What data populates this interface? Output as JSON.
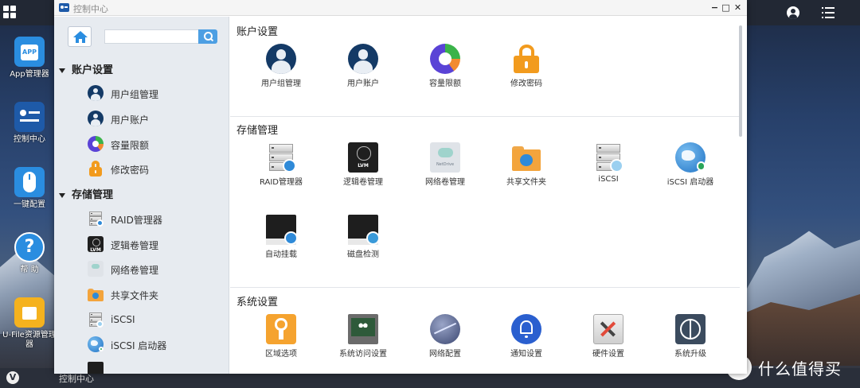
{
  "desktop": {
    "icons": [
      {
        "label": "App管理器",
        "icon": "app-store-icon"
      },
      {
        "label": "控制中心",
        "icon": "control-center-icon"
      },
      {
        "label": "一键配置",
        "icon": "mouse-icon"
      },
      {
        "label": "帮 助",
        "icon": "help-icon"
      },
      {
        "label": "U-File资源管理器",
        "icon": "file-manager-icon"
      }
    ],
    "taskbar_task": "控制中心",
    "watermark": "什么值得买",
    "watermark_badge": "值"
  },
  "window": {
    "title": "控制中心",
    "buttons": {
      "minimize": "−",
      "maximize": "□",
      "close": "✕"
    }
  },
  "sidebar": {
    "search": {
      "value": "",
      "placeholder": ""
    },
    "groups": [
      {
        "label": "账户设置",
        "items": [
          "用户组管理",
          "用户账户",
          "容量限额",
          "修改密码"
        ]
      },
      {
        "label": "存储管理",
        "items": [
          "RAID管理器",
          "逻辑卷管理",
          "网络卷管理",
          "共享文件夹",
          "iSCSI",
          "iSCSI 启动器"
        ]
      }
    ]
  },
  "content": {
    "sections": [
      {
        "title": "账户设置",
        "tiles": [
          {
            "label": "用户组管理",
            "icon": "user-group-icon"
          },
          {
            "label": "用户账户",
            "icon": "user-account-icon"
          },
          {
            "label": "容量限额",
            "icon": "quota-icon"
          },
          {
            "label": "修改密码",
            "icon": "lock-icon"
          }
        ]
      },
      {
        "title": "存储管理",
        "tiles": [
          {
            "label": "RAID管理器",
            "icon": "raid-icon"
          },
          {
            "label": "逻辑卷管理",
            "icon": "lvm-icon",
            "text": "LVM"
          },
          {
            "label": "网络卷管理",
            "icon": "net-drive-icon",
            "text": "NetDrive"
          },
          {
            "label": "共享文件夹",
            "icon": "shared-folder-icon"
          },
          {
            "label": "iSCSI",
            "icon": "iscsi-icon"
          },
          {
            "label": "iSCSI 启动器",
            "icon": "iscsi-initiator-icon"
          },
          {
            "label": "自动挂载",
            "icon": "auto-mount-icon"
          },
          {
            "label": "磁盘检测",
            "icon": "disk-check-icon"
          }
        ]
      },
      {
        "title": "系统设置",
        "tiles": [
          {
            "label": "区域选项",
            "icon": "region-icon"
          },
          {
            "label": "系统访问设置",
            "icon": "system-access-icon"
          },
          {
            "label": "网络配置",
            "icon": "network-icon"
          },
          {
            "label": "通知设置",
            "icon": "notification-icon"
          },
          {
            "label": "硬件设置",
            "icon": "hardware-icon"
          },
          {
            "label": "系统升级",
            "icon": "upgrade-icon"
          }
        ]
      }
    ]
  }
}
